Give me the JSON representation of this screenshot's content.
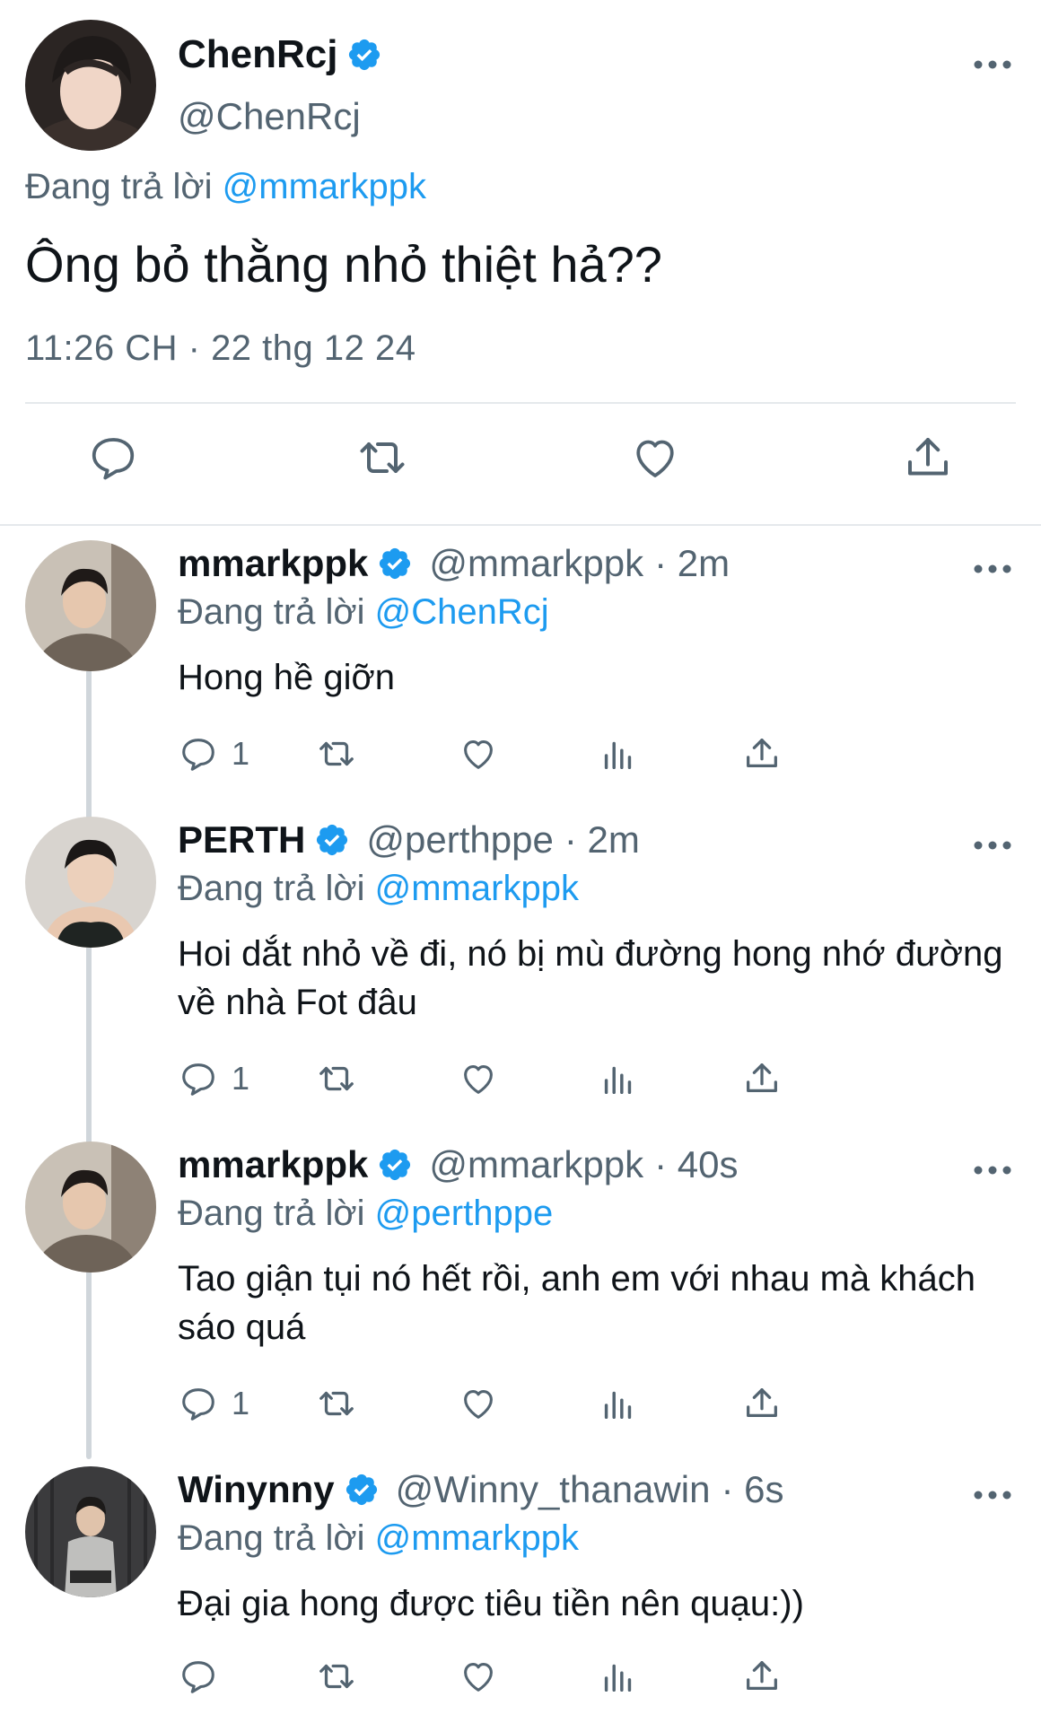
{
  "main_tweet": {
    "display_name": "ChenRcj",
    "handle": "@ChenRcj",
    "replying_prefix": "Đang trả lời",
    "replying_to": "@mmarkppk",
    "text": "Ông bỏ thằng nhỏ thiệt hả??",
    "timestamp": "11:26 CH · 22 thg 12 24",
    "actions": [
      "reply-icon",
      "retweet-icon",
      "like-icon",
      "share-icon"
    ]
  },
  "replies": [
    {
      "display_name": "mmarkppk",
      "handle": "@mmarkppk",
      "time": "· 2m",
      "replying_prefix": "Đang trả lời",
      "replying_to": "@ChenRcj",
      "text": "Hong hề giỡn",
      "reply_count": "1"
    },
    {
      "display_name": "PERTH",
      "handle": "@perthppe",
      "time": "· 2m",
      "replying_prefix": "Đang trả lời",
      "replying_to": "@mmarkppk",
      "text": "Hoi dắt nhỏ về đi, nó bị mù đường hong nhớ đường về nhà Fot đâu",
      "reply_count": "1"
    },
    {
      "display_name": "mmarkppk",
      "handle": "@mmarkppk",
      "time": "· 40s",
      "replying_prefix": "Đang trả lời",
      "replying_to": "@perthppe",
      "text": "Tao giận tụi nó hết rồi, anh em với nhau mà khách sáo quá",
      "reply_count": "1"
    },
    {
      "display_name": "Winynny",
      "handle": "@Winny_thanawin",
      "time": "· 6s",
      "replying_prefix": "Đang trả lời",
      "replying_to": "@mmarkppk",
      "text": "Đại gia hong được tiêu tiền nên quạu:))",
      "reply_count": ""
    }
  ],
  "colors": {
    "link": "#1d9bf0",
    "secondary_text": "#536471",
    "verified_badge": "#1d9bf0",
    "divider": "#e5e9ec"
  }
}
